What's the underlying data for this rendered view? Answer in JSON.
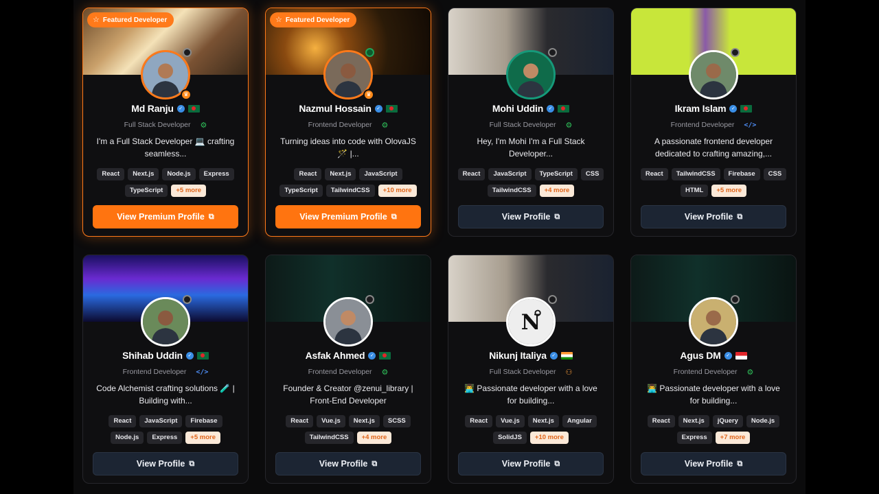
{
  "featured_badge": "Featured Developer",
  "cards": [
    {
      "name": "Md Ranju",
      "flag": "bd",
      "role": "Full Stack Developer",
      "role_icon": "chip-icon",
      "bio": "I'm a Full Stack Developer 💻 crafting seamless...",
      "tags": [
        "React",
        "Next.js",
        "Node.js",
        "Express",
        "TypeScript"
      ],
      "more": "+5 more",
      "button": "View Premium Profile",
      "premium": true
    },
    {
      "name": "Nazmul Hossain",
      "flag": "bd",
      "role": "Frontend Developer",
      "role_icon": "chip-icon",
      "bio": "Turning ideas into code with OlovaJS 🪄 |...",
      "tags": [
        "React",
        "Next.js",
        "JavaScript",
        "TypeScript",
        "TailwindCSS"
      ],
      "more": "+10 more",
      "button": "View Premium Profile",
      "premium": true
    },
    {
      "name": "Mohi Uddin",
      "flag": "bd",
      "role": "Full Stack Developer",
      "role_icon": "chip-icon",
      "bio": "Hey, I'm Mohi I'm a Full Stack Developer...",
      "tags": [
        "React",
        "JavaScript",
        "TypeScript",
        "CSS",
        "TailwindCSS"
      ],
      "more": "+4 more",
      "button": "View Profile",
      "premium": false
    },
    {
      "name": "Ikram Islam",
      "flag": "bd",
      "role": "Frontend Developer",
      "role_icon": "code-icon",
      "bio": "A passionate frontend developer dedicated to crafting amazing,...",
      "tags": [
        "React",
        "TailwindCSS",
        "Firebase",
        "CSS",
        "HTML"
      ],
      "more": "+5 more",
      "button": "View Profile",
      "premium": false
    },
    {
      "name": "Shihab Uddin",
      "flag": "bd",
      "role": "Frontend Developer",
      "role_icon": "code-icon",
      "bio": "Code Alchemist crafting solutions 🧪 | Building with...",
      "tags": [
        "React",
        "JavaScript",
        "Firebase",
        "Node.js",
        "Express"
      ],
      "more": "+5 more",
      "button": "View Profile",
      "premium": false
    },
    {
      "name": "Asfak Ahmed",
      "flag": "bd",
      "role": "Frontend Developer",
      "role_icon": "chip-icon",
      "bio": "Founder & Creator @zenui_library | Front-End Developer",
      "tags": [
        "React",
        "Vue.js",
        "Next.js",
        "SCSS",
        "TailwindCSS"
      ],
      "more": "+4 more",
      "button": "View Profile",
      "premium": false
    },
    {
      "name": "Nikunj Italiya",
      "flag": "in",
      "role": "Full Stack Developer",
      "role_icon": "users-icon",
      "bio": "👨‍💻 Passionate developer with a love for building...",
      "tags": [
        "React",
        "Vue.js",
        "Next.js",
        "Angular",
        "SolidJS"
      ],
      "more": "+10 more",
      "button": "View Profile",
      "premium": false
    },
    {
      "name": "Agus DM",
      "flag": "id",
      "role": "Frontend Developer",
      "role_icon": "chip-icon",
      "bio": "👨‍💻 Passionate developer with a love for building...",
      "tags": [
        "React",
        "Next.js",
        "jQuery",
        "Node.js",
        "Express"
      ],
      "more": "+7 more",
      "button": "View Profile",
      "premium": false
    }
  ],
  "colors": {
    "accent": "#ff7410",
    "card_bg": "#0f0f11",
    "button_bg": "#1c2533",
    "tag_more_bg": "#fbe9d8"
  }
}
